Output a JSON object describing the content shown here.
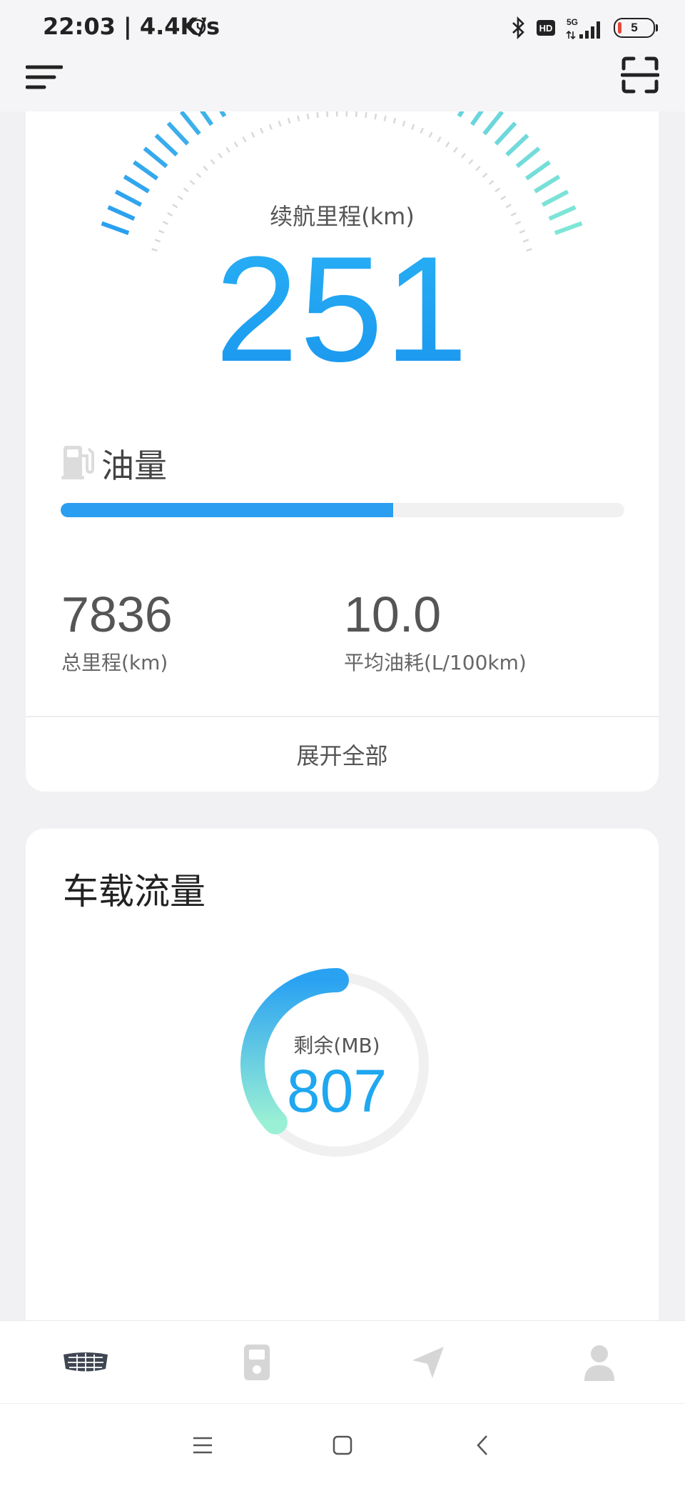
{
  "status_bar": {
    "time": "22:03 | 4.4K/s",
    "network_label": "5G",
    "hd_label": "HD",
    "battery_level": "5",
    "icons": [
      "alarm-icon",
      "bluetooth-icon",
      "hd-icon",
      "signal-5g-icon",
      "battery-icon"
    ]
  },
  "app_bar": {
    "left_icon": "menu-icon",
    "right_icon": "scan-icon"
  },
  "vehicle_card": {
    "range_label": "续航里程(km)",
    "range_value": "251",
    "fuel_label": "油量",
    "fuel_level_fraction": 0.59,
    "stats": [
      {
        "value": "7836",
        "label": "总里程(km)"
      },
      {
        "value": "10.0",
        "label": "平均油耗(L/100km)"
      }
    ],
    "expand_label": "展开全部"
  },
  "data_card": {
    "title": "车载流量",
    "remaining_label": "剩余(MB)",
    "remaining_value": "807",
    "used_fraction_shown": 0.37
  },
  "bottom_nav": {
    "items": [
      {
        "icon": "car-logo-icon",
        "active": true
      },
      {
        "icon": "car-key-icon",
        "active": false
      },
      {
        "icon": "navigation-icon",
        "active": false
      },
      {
        "icon": "profile-icon",
        "active": false
      }
    ]
  },
  "system_nav": {
    "items": [
      "recents-icon",
      "home-icon",
      "back-icon"
    ]
  },
  "colors": {
    "accent": "#1fa7f0",
    "gauge_start": "#2aa0f0",
    "gauge_end": "#7fe6d6",
    "background": "#f1f1f3",
    "card": "#ffffff"
  }
}
